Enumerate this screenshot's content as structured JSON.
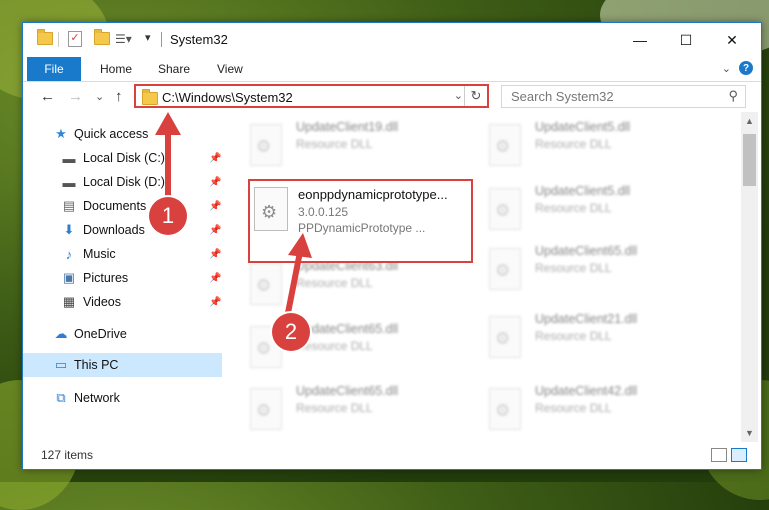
{
  "window": {
    "title": "System32",
    "controls": {
      "minimize": "—",
      "maximize": "☐",
      "close": "✕"
    }
  },
  "ribbon": {
    "tabs": [
      {
        "label": "File",
        "active": true
      },
      {
        "label": "Home"
      },
      {
        "label": "Share"
      },
      {
        "label": "View"
      }
    ],
    "help": "?",
    "expand_icon": "⌄"
  },
  "nav": {
    "back": "←",
    "forward": "→",
    "recent": "⌄",
    "up": "↑",
    "address": "C:\\Windows\\System32",
    "search_placeholder": "Search System32"
  },
  "sidebar": {
    "items": [
      {
        "label": "Quick access",
        "icon": "star-icon",
        "glyph": "★",
        "color": "#2b8ad8"
      },
      {
        "label": "Local Disk (C:)",
        "icon": "drive-icon",
        "glyph": "▬",
        "pinned": true
      },
      {
        "label": "Local Disk (D:)",
        "icon": "drive-icon",
        "glyph": "▬",
        "pinned": true
      },
      {
        "label": "Documents",
        "icon": "documents-icon",
        "glyph": "▤",
        "pinned": true
      },
      {
        "label": "Downloads",
        "icon": "downloads-icon",
        "glyph": "⬇",
        "color": "#2b7fd0",
        "pinned": true
      },
      {
        "label": "Music",
        "icon": "music-icon",
        "glyph": "♪",
        "color": "#2b7fd0",
        "pinned": true
      },
      {
        "label": "Pictures",
        "icon": "pictures-icon",
        "glyph": "▣",
        "pinned": true
      },
      {
        "label": "Videos",
        "icon": "videos-icon",
        "glyph": "▦",
        "pinned": true
      },
      {
        "label": "OneDrive",
        "icon": "cloud-icon",
        "glyph": "☁",
        "color": "#2b7fd0"
      },
      {
        "label": "This PC",
        "icon": "computer-icon",
        "glyph": "▭",
        "color": "#2b7fd0",
        "selected": true
      },
      {
        "label": "Network",
        "icon": "network-icon",
        "glyph": "⧉",
        "color": "#2b7fd0"
      }
    ]
  },
  "files": {
    "highlighted": {
      "name": "eonppdynamicprototype...",
      "version": "3.0.0.125",
      "description": "PPDynamicPrototype ..."
    },
    "left_column": [
      {
        "name": "UpdateClient19.dll",
        "desc": "Resource DLL"
      },
      {
        "name": "UpdateClient63.dll",
        "desc": "Resource DLL"
      },
      {
        "name": "UpdateClient65.dll",
        "desc": "Resource DLL"
      },
      {
        "name": "UpdateClient65.dll",
        "desc": "Resource DLL"
      }
    ],
    "right_column": [
      {
        "name": "UpdateClient5.dll",
        "desc": "Resource DLL"
      },
      {
        "name": "UpdateClient5.dll",
        "desc": "Resource DLL"
      },
      {
        "name": "UpdateClient65.dll",
        "desc": "Resource DLL"
      },
      {
        "name": "UpdateClient21.dll",
        "desc": "Resource DLL"
      },
      {
        "name": "UpdateClient42.dll",
        "desc": "Resource DLL"
      }
    ]
  },
  "status": {
    "count": "127 items"
  },
  "annotations": {
    "step1": "1",
    "step2": "2"
  },
  "colors": {
    "accent": "#1979ca",
    "annotation_red": "#d9413f",
    "selection": "#cce8ff"
  }
}
